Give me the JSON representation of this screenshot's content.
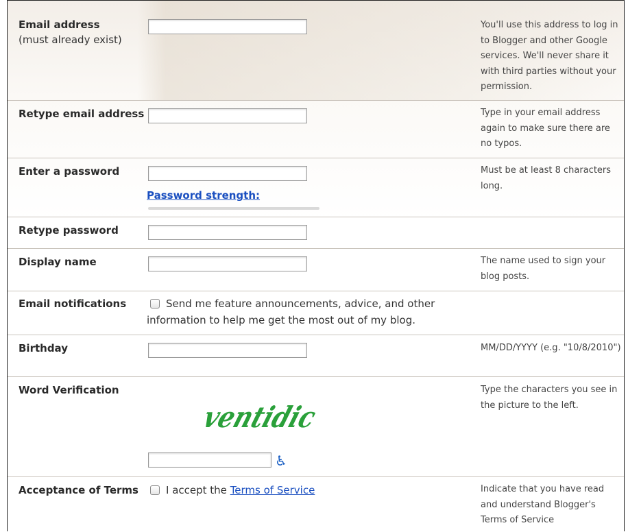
{
  "rows": {
    "email": {
      "label": "Email address",
      "sublabel": "(must already exist)",
      "help": "You'll use this address to log in to Blogger and other Google services. We'll never share it with third parties without your permission."
    },
    "retype_email": {
      "label": "Retype email address",
      "help": "Type in your email address again to make sure there are no typos."
    },
    "password": {
      "label": "Enter a password",
      "strength_link": "Password strength:",
      "help": "Must be at least 8 characters long."
    },
    "retype_password": {
      "label": "Retype password"
    },
    "display_name": {
      "label": "Display name",
      "help": "The name used to sign your blog posts."
    },
    "notifications": {
      "label": "Email notifications",
      "checkbox_text": "Send me feature announcements, advice, and other information to help me get the most out of my blog.",
      "checked": false
    },
    "birthday": {
      "label": "Birthday",
      "help": "MM/DD/YYYY (e.g. \"10/8/2010\")"
    },
    "word_verification": {
      "label": "Word Verification",
      "captcha_text": "ventidic",
      "help": "Type the characters you see in the picture to the left.",
      "accessibility_icon": "wheelchair-icon",
      "captcha_color": "#2aa03a"
    },
    "terms": {
      "label": "Acceptance of Terms",
      "accept_prefix": "I accept the",
      "tos_link": "Terms of Service",
      "help": "Indicate that you have read and understand Blogger's Terms of Service",
      "checked": false
    }
  },
  "colors": {
    "link": "#1a4fc0",
    "divider": "#c9c3bb"
  }
}
